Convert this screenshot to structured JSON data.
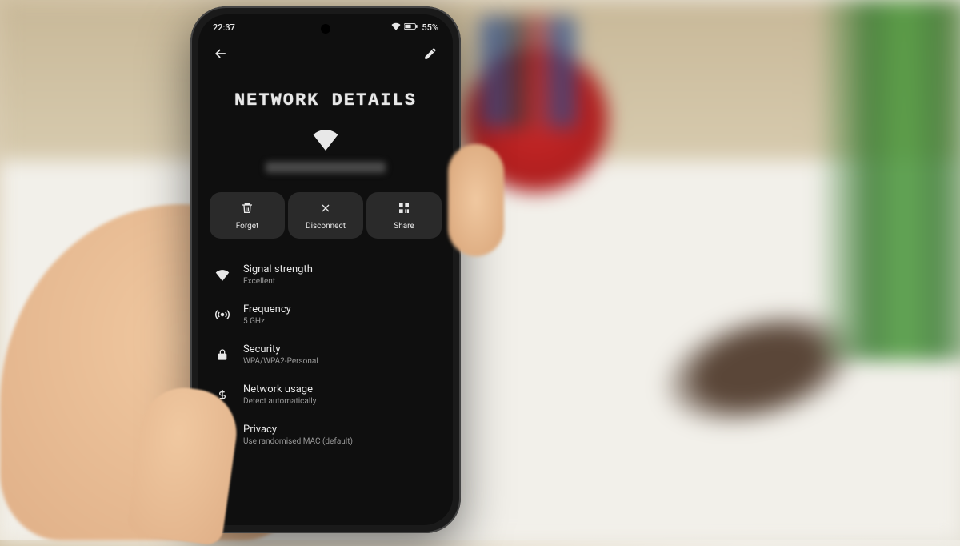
{
  "statusbar": {
    "time": "22:37",
    "battery": "55%"
  },
  "page": {
    "title": "NETWORK DETAILS"
  },
  "actions": {
    "forget": "Forget",
    "disconnect": "Disconnect",
    "share": "Share"
  },
  "settings": [
    {
      "label": "Signal strength",
      "value": "Excellent"
    },
    {
      "label": "Frequency",
      "value": "5 GHz"
    },
    {
      "label": "Security",
      "value": "WPA/WPA2-Personal"
    },
    {
      "label": "Network usage",
      "value": "Detect automatically"
    },
    {
      "label": "Privacy",
      "value": "Use randomised MAC (default)"
    }
  ]
}
